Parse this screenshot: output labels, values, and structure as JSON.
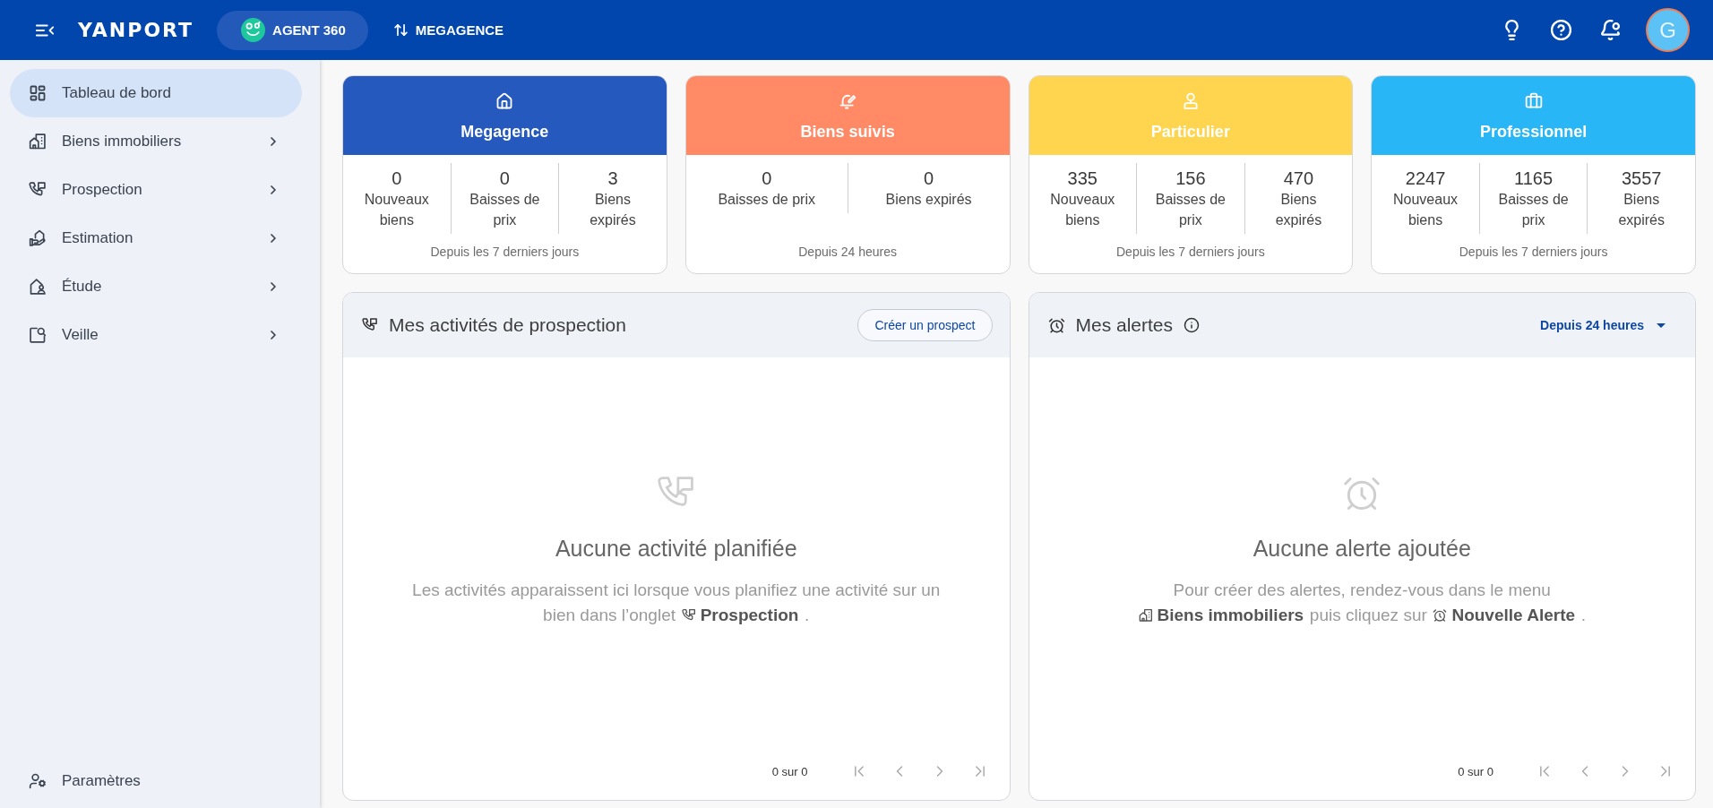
{
  "top_bar": {
    "logo": "YANPORT",
    "product": "AGENT 360",
    "switch": "MEGAGENCE",
    "avatar": "G"
  },
  "sidebar": {
    "items": [
      {
        "label": "Tableau de bord",
        "selected": true,
        "expandable": false
      },
      {
        "label": "Biens immobiliers",
        "selected": false,
        "expandable": true
      },
      {
        "label": "Prospection",
        "selected": false,
        "expandable": true
      },
      {
        "label": "Estimation",
        "selected": false,
        "expandable": true
      },
      {
        "label": "Étude",
        "selected": false,
        "expandable": true
      },
      {
        "label": "Veille",
        "selected": false,
        "expandable": true
      }
    ],
    "footer_item": {
      "label": "Paramètres"
    }
  },
  "cards": [
    {
      "title": "Megagence",
      "color": "#2559bd",
      "stats": [
        {
          "value": "0",
          "label": "Nouveaux biens"
        },
        {
          "value": "0",
          "label": "Baisses de prix"
        },
        {
          "value": "3",
          "label": "Biens expirés"
        }
      ],
      "period": "Depuis les 7 derniers jours"
    },
    {
      "title": "Biens suivis",
      "color": "#ff8a65",
      "stats": [
        {
          "value": "0",
          "label": "Baisses de prix"
        },
        {
          "value": "0",
          "label": "Biens expirés"
        }
      ],
      "period": "Depuis 24 heures"
    },
    {
      "title": "Particulier",
      "color": "#ffd54f",
      "stats": [
        {
          "value": "335",
          "label": "Nouveaux biens"
        },
        {
          "value": "156",
          "label": "Baisses de prix"
        },
        {
          "value": "470",
          "label": "Biens expirés"
        }
      ],
      "period": "Depuis les 7 derniers jours"
    },
    {
      "title": "Professionnel",
      "color": "#29b6f6",
      "stats": [
        {
          "value": "2247",
          "label": "Nouveaux biens"
        },
        {
          "value": "1165",
          "label": "Baisses de prix"
        },
        {
          "value": "3557",
          "label": "Biens expirés"
        }
      ],
      "period": "Depuis les 7 derniers jours"
    }
  ],
  "panels": [
    {
      "kind": "activities",
      "title": "Mes activités de prospection",
      "action": "Créer un prospect",
      "empty": {
        "title": "Aucune activité planifiée",
        "lines": [
          [
            {
              "kind": "text",
              "text": "Les activités apparaissent ici lorsque vous planifiez une activité sur un"
            }
          ],
          [
            {
              "kind": "text",
              "text": "bien dans l’onglet"
            },
            {
              "kind": "link",
              "text": "Prospection"
            },
            {
              "kind": "text",
              "text": "."
            }
          ]
        ]
      },
      "pagination": {
        "label": "0 sur 0",
        "disabled": true
      }
    },
    {
      "kind": "alerts",
      "title": "Mes alertes",
      "filter": "Depuis 24 heures",
      "empty": {
        "title": "Aucune alerte ajoutée",
        "lines": [
          [
            {
              "kind": "text",
              "text": "Pour créer des alertes, rendez-vous dans le menu"
            }
          ],
          [
            {
              "kind": "link",
              "text": "Biens immobiliers"
            },
            {
              "kind": "text",
              "text": "puis cliquez sur"
            },
            {
              "kind": "link",
              "text": "Nouvelle Alerte"
            },
            {
              "kind": "text",
              "text": "."
            }
          ]
        ]
      },
      "pagination": {
        "label": "0 sur 0",
        "disabled": true
      }
    }
  ]
}
